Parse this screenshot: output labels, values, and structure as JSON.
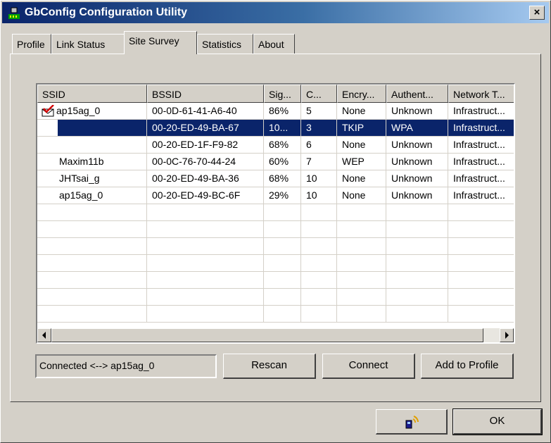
{
  "window": {
    "title": "GbConfig Configuration Utility",
    "close_label": "×"
  },
  "tabs": [
    {
      "label": "Profile"
    },
    {
      "label": "Link Status"
    },
    {
      "label": "Site Survey",
      "active": true
    },
    {
      "label": "Statistics"
    },
    {
      "label": "About"
    }
  ],
  "table": {
    "columns": [
      "SSID",
      "BSSID",
      "Sig...",
      "C...",
      "Encry...",
      "Authent...",
      "Network T..."
    ],
    "rows": [
      {
        "ssid": "ap15ag_0",
        "bssid": "00-0D-61-41-A6-40",
        "signal": "86%",
        "channel": "5",
        "encryption": "None",
        "auth": "Unknown",
        "network": "Infrastruct...",
        "connected": true
      },
      {
        "ssid": "",
        "bssid": "00-20-ED-49-BA-67",
        "signal": "10...",
        "channel": "3",
        "encryption": "TKIP",
        "auth": "WPA",
        "network": "Infrastruct...",
        "selected": true
      },
      {
        "ssid": "",
        "bssid": "00-20-ED-1F-F9-82",
        "signal": "68%",
        "channel": "6",
        "encryption": "None",
        "auth": "Unknown",
        "network": "Infrastruct..."
      },
      {
        "ssid": "Maxim11b",
        "bssid": "00-0C-76-70-44-24",
        "signal": "60%",
        "channel": "7",
        "encryption": "WEP",
        "auth": "Unknown",
        "network": "Infrastruct..."
      },
      {
        "ssid": "JHTsai_g",
        "bssid": "00-20-ED-49-BA-36",
        "signal": "68%",
        "channel": "10",
        "encryption": "None",
        "auth": "Unknown",
        "network": "Infrastruct..."
      },
      {
        "ssid": "ap15ag_0",
        "bssid": "00-20-ED-49-BC-6F",
        "signal": "29%",
        "channel": "10",
        "encryption": "None",
        "auth": "Unknown",
        "network": "Infrastruct..."
      }
    ]
  },
  "status": {
    "text": "Connected <--> ap15ag_0"
  },
  "buttons": {
    "rescan": "Rescan",
    "connect": "Connect",
    "add_profile": "Add to Profile",
    "ok": "OK"
  },
  "icons": {
    "app": "network-app-icon",
    "connected": "connected-check-icon",
    "wireless": "wireless-signal-icon"
  }
}
